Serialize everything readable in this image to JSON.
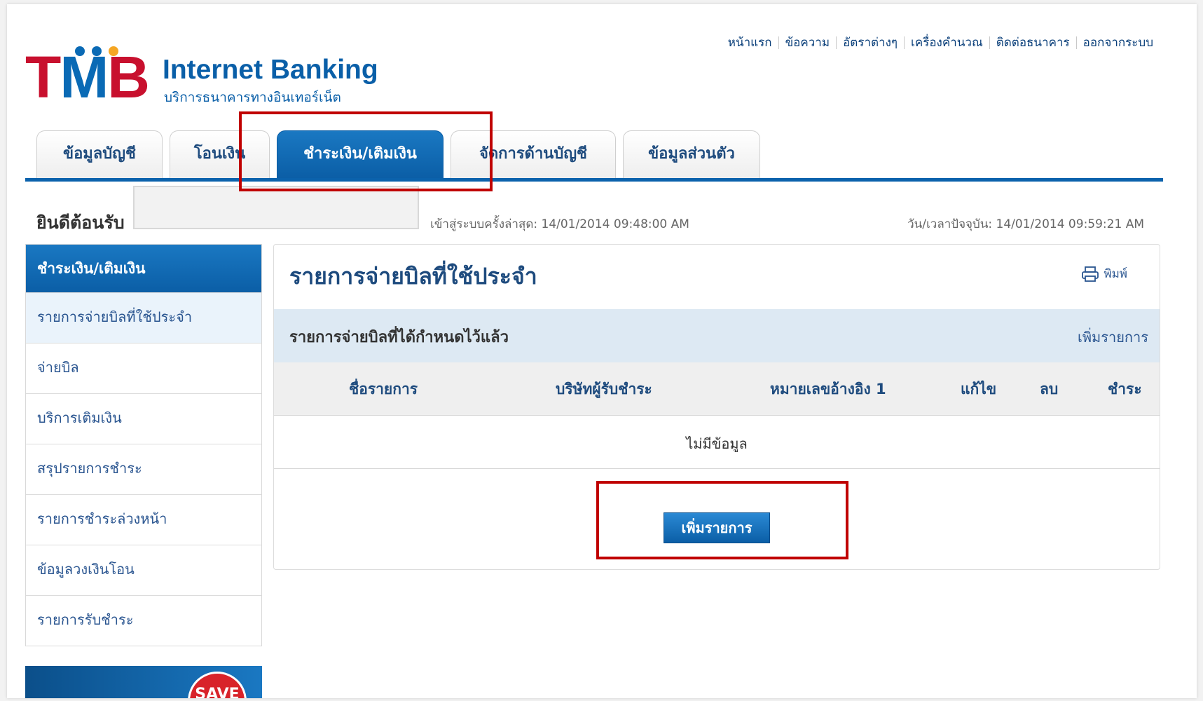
{
  "brand": {
    "logo_text": "TMB",
    "title": "Internet Banking",
    "subtitle": "บริการธนาคารทางอินเทอร์เน็ต"
  },
  "top_links": [
    "หน้าแรก",
    "ข้อความ",
    "อัตราต่างๆ",
    "เครื่องคำนวณ",
    "ติดต่อธนาคาร",
    "ออกจากระบบ"
  ],
  "tabs": [
    {
      "label": "ข้อมูลบัญชี"
    },
    {
      "label": "โอนเงิน"
    },
    {
      "label": "ชำระเงิน/เติมเงิน",
      "active": true
    },
    {
      "label": "จัดการด้านบัญชี"
    },
    {
      "label": "ข้อมูลส่วนตัว"
    }
  ],
  "welcome": {
    "greeting": "ยินดีต้อนรับ",
    "last_login": "เข้าสู่ระบบครั้งล่าสุด: 14/01/2014 09:48:00 AM",
    "current_time": "วัน/เวลาปัจจุบัน: 14/01/2014 09:59:21 AM"
  },
  "sidebar": {
    "header": "ชำระเงิน/เติมเงิน",
    "items": [
      {
        "label": "รายการจ่ายบิลที่ใช้ประจำ"
      },
      {
        "label": "จ่ายบิล"
      },
      {
        "label": "บริการเติมเงิน"
      },
      {
        "label": "สรุปรายการชำระ"
      },
      {
        "label": "รายการชำระล่วงหน้า"
      },
      {
        "label": "ข้อมูลวงเงินโอน"
      },
      {
        "label": "รายการรับชำระ"
      }
    ],
    "ad_text": "SAVE"
  },
  "main": {
    "title": "รายการจ่ายบิลที่ใช้ประจำ",
    "print_label": "พิมพ์",
    "section_title": "รายการจ่ายบิลที่ได้กำหนดไว้แล้ว",
    "section_add_link": "เพิ่มรายการ",
    "columns": [
      "ชื่อรายการ",
      "บริษัทผู้รับชำระ",
      "หมายเลขอ้างอิง 1",
      "แก้ไข",
      "ลบ",
      "ชำระ"
    ],
    "empty_text": "ไม่มีข้อมูล",
    "add_button": "เพิ่มรายการ"
  },
  "colors": {
    "brand_red": "#c8102e",
    "brand_blue": "#0a6ab5",
    "tab_active": "#0b5ea6",
    "highlight": "#c00000"
  }
}
